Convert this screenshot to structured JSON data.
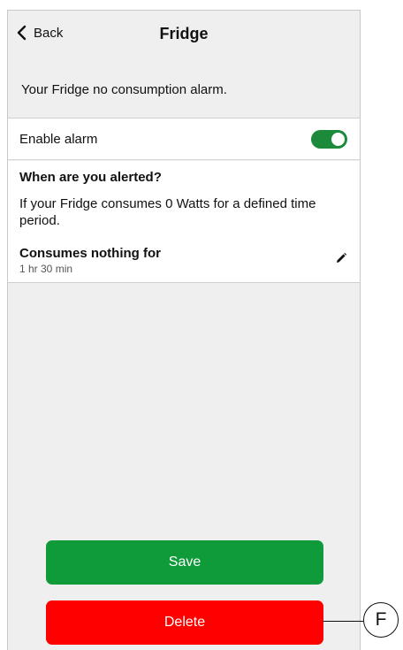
{
  "header": {
    "back_label": "Back",
    "title": "Fridge"
  },
  "description": "Your Fridge no consumption alarm.",
  "alarm": {
    "label": "Enable alarm",
    "enabled": true
  },
  "info": {
    "heading": "When are you alerted?",
    "text": "If your Fridge consumes 0 Watts for a defined time period.",
    "consumes_title": "Consumes nothing for",
    "consumes_value": "1 hr 30 min"
  },
  "buttons": {
    "save_label": "Save",
    "delete_label": "Delete"
  },
  "callout": {
    "label": "F"
  },
  "colors": {
    "save": "#0f9b3a",
    "delete": "#ff0000",
    "toggle_on": "#1b8a3a"
  }
}
